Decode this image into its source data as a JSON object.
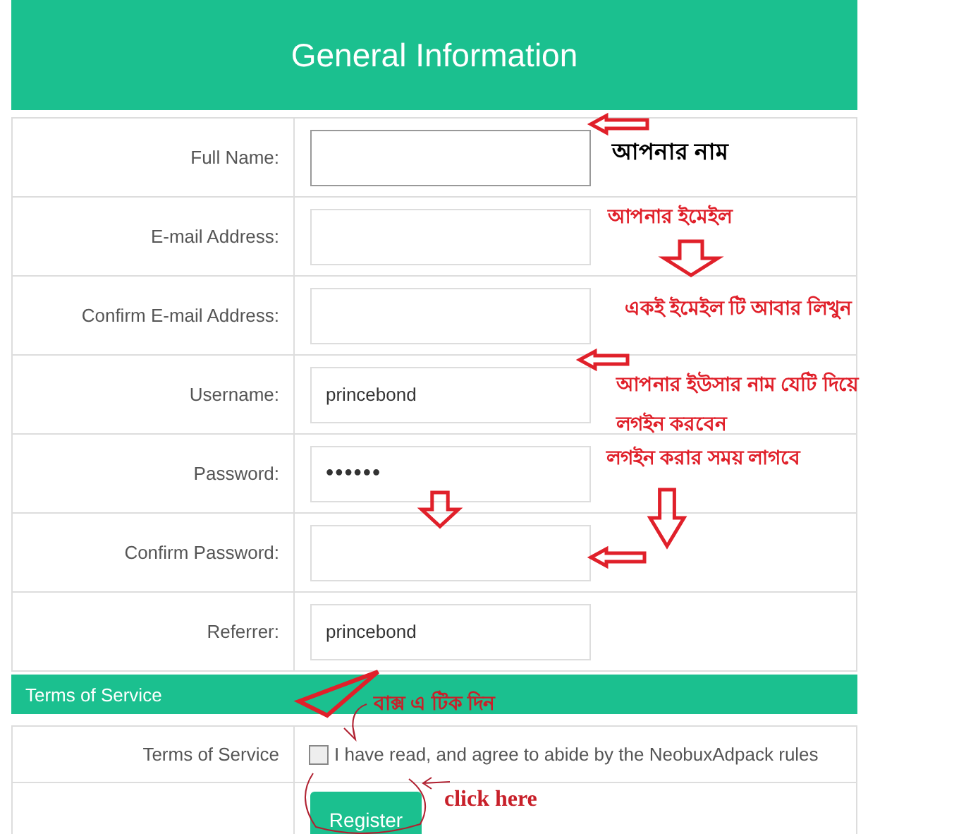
{
  "header": {
    "title": "General Information"
  },
  "fields": [
    {
      "label": "Full Name:",
      "kind": "text",
      "focused": true
    },
    {
      "label": "E-mail Address:",
      "kind": "text",
      "focused": false
    },
    {
      "label": "Confirm E-mail Address:",
      "kind": "text",
      "focused": false
    },
    {
      "label": "Username:",
      "kind": "text",
      "value": "princebond",
      "focused": false
    },
    {
      "label": "Password:",
      "kind": "password",
      "value": "••••••",
      "focused": false
    },
    {
      "label": "Confirm Password:",
      "kind": "password",
      "focused": false
    },
    {
      "label": "Referrer:",
      "kind": "text",
      "value": "princebond",
      "focused": false
    }
  ],
  "terms_section": {
    "title": "Terms of Service",
    "label": "Terms of Service",
    "checkbox_text": "I have read, and agree to abide by the NeobuxAdpack rules",
    "checked": false
  },
  "register_button": "Register",
  "notes": [
    {
      "text": "আপনার নাম",
      "color": "#000000"
    },
    {
      "text": "আপনার ইমেইল",
      "color": "#e0202a"
    },
    {
      "text": "একই ইমেইল টি আবার লিখুন",
      "color": "#e0202a"
    },
    {
      "text": "আপনার ইউসার নাম যেটি দিয়ে",
      "color": "#e0202a"
    },
    {
      "text": "লগইন করবেন",
      "color": "#e0202a"
    },
    {
      "text": "লগইন করার সময় লাগবে",
      "color": "#e0202a"
    },
    {
      "text": "বাক্স এ টিক দিন",
      "color": "#c8202a"
    },
    {
      "text": "click here",
      "color": "#c8202a"
    }
  ]
}
